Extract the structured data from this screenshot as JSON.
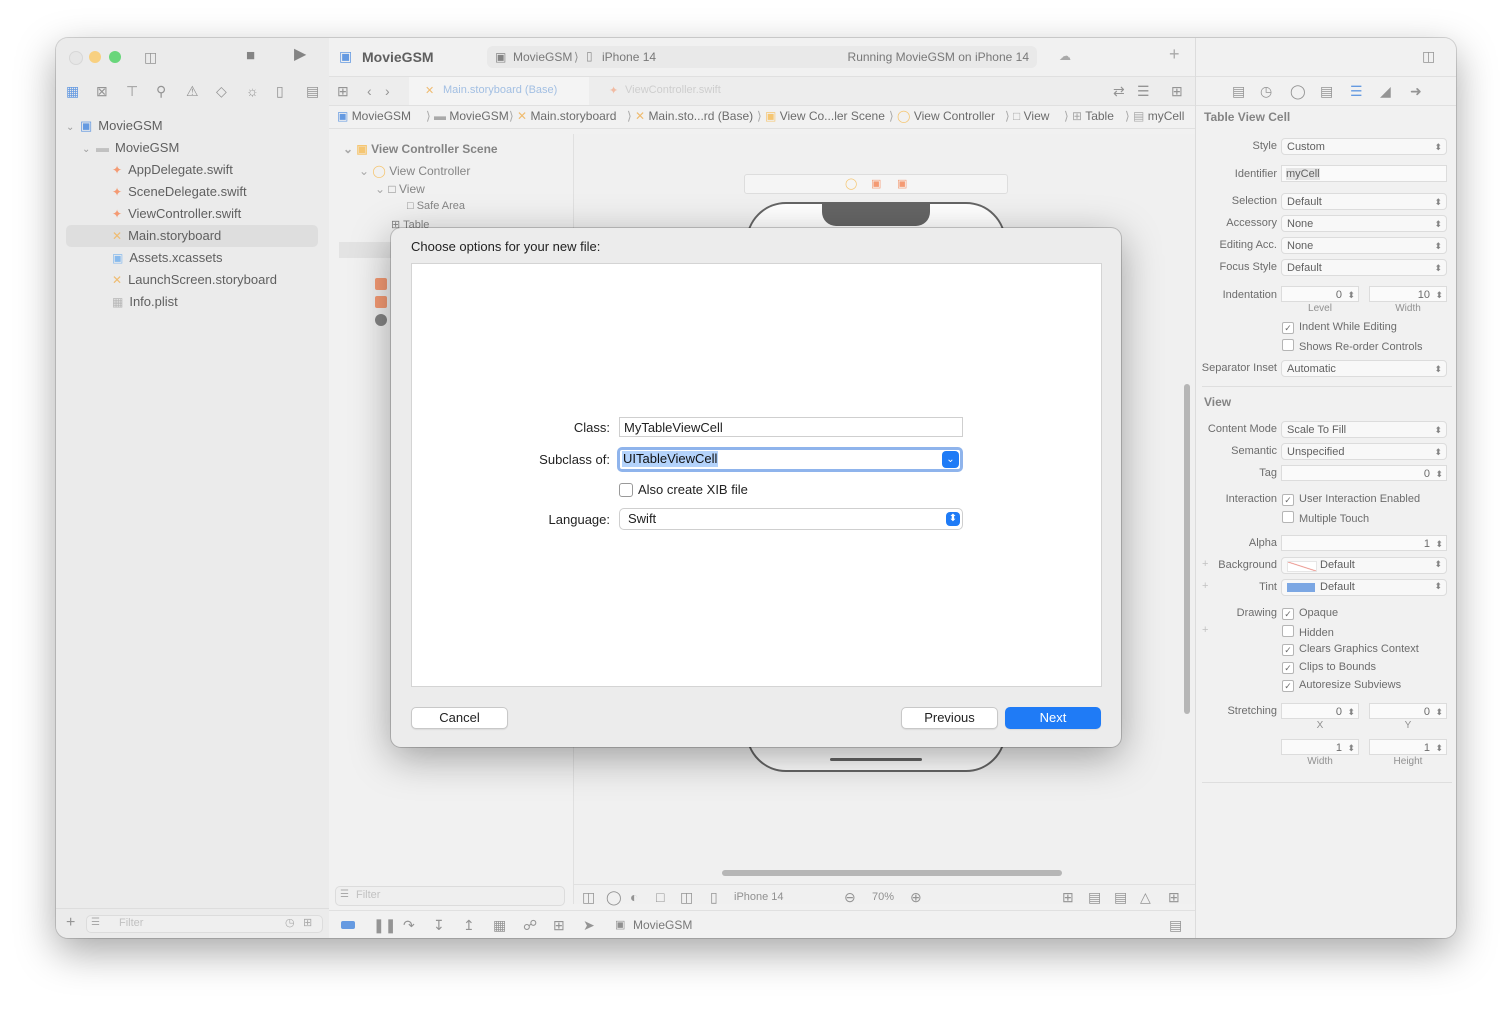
{
  "window": {
    "app_title": "MovieGSM",
    "scheme": "MovieGSM",
    "device": "iPhone 14",
    "status": "Running MovieGSM on iPhone 14"
  },
  "tabs": [
    {
      "label": "Main.storyboard (Base)"
    },
    {
      "label": "ViewController.swift"
    }
  ],
  "navigator": {
    "items": [
      {
        "label": "MovieGSM",
        "kind": "project"
      },
      {
        "label": "MovieGSM",
        "kind": "folder"
      },
      {
        "label": "AppDelegate.swift",
        "kind": "swift"
      },
      {
        "label": "SceneDelegate.swift",
        "kind": "swift"
      },
      {
        "label": "ViewController.swift",
        "kind": "swift"
      },
      {
        "label": "Main.storyboard",
        "kind": "storyboard"
      },
      {
        "label": "Assets.xcassets",
        "kind": "assets"
      },
      {
        "label": "LaunchScreen.storyboard",
        "kind": "storyboard"
      },
      {
        "label": "Info.plist",
        "kind": "plist"
      }
    ],
    "filter_placeholder": "Filter"
  },
  "breadcrumb": [
    "MovieGSM",
    "MovieGSM",
    "Main.storyboard",
    "Main.sto...rd (Base)",
    "View Co...ler Scene",
    "View Controller",
    "View",
    "Table",
    "myCell"
  ],
  "outline": {
    "scene": "View Controller Scene",
    "controller": "View Controller",
    "view": "View",
    "safe_area": "Safe Area",
    "table": "Table",
    "filter_placeholder": "Filter"
  },
  "canvas_bar": {
    "device": "iPhone 14",
    "zoom": "70%"
  },
  "debug_bar": {
    "target": "MovieGSM"
  },
  "inspector": {
    "title": "Table View Cell",
    "style_label": "Style",
    "style_value": "Custom",
    "identifier_label": "Identifier",
    "identifier_value": "myCell",
    "selection_label": "Selection",
    "selection_value": "Default",
    "accessory_label": "Accessory",
    "accessory_value": "None",
    "editing_label": "Editing Acc.",
    "editing_value": "None",
    "focus_label": "Focus Style",
    "focus_value": "Default",
    "indentation_label": "Indentation",
    "level_value": "0",
    "level_label": "Level",
    "width_value": "10",
    "width_label": "Width",
    "indent_while_editing": "Indent While Editing",
    "shows_reorder": "Shows Re-order Controls",
    "separator_label": "Separator Inset",
    "separator_value": "Automatic",
    "view_section": "View",
    "content_mode_label": "Content Mode",
    "content_mode_value": "Scale To Fill",
    "semantic_label": "Semantic",
    "semantic_value": "Unspecified",
    "tag_label": "Tag",
    "tag_value": "0",
    "interaction_label": "Interaction",
    "user_interaction": "User Interaction Enabled",
    "multiple_touch": "Multiple Touch",
    "alpha_label": "Alpha",
    "alpha_value": "1",
    "background_label": "Background",
    "background_value": "Default",
    "tint_label": "Tint",
    "tint_value": "Default",
    "tint_color": "#4a86d8",
    "drawing_label": "Drawing",
    "opaque": "Opaque",
    "hidden": "Hidden",
    "clears_context": "Clears Graphics Context",
    "clips_bounds": "Clips to Bounds",
    "autoresize": "Autoresize Subviews",
    "stretching_label": "Stretching",
    "stretch_x": "0",
    "stretch_y": "0",
    "stretch_w": "1",
    "stretch_h": "1",
    "x_label": "X",
    "y_label": "Y",
    "w_label": "Width",
    "h_label": "Height"
  },
  "dialog": {
    "title": "Choose options for your new file:",
    "class_label": "Class:",
    "class_value": "MyTableViewCell",
    "subclass_label": "Subclass of:",
    "subclass_value": "UITableViewCell",
    "xib_label": "Also create XIB file",
    "language_label": "Language:",
    "language_value": "Swift",
    "cancel": "Cancel",
    "previous": "Previous",
    "next": "Next",
    "accent": "#1f7bf6"
  }
}
